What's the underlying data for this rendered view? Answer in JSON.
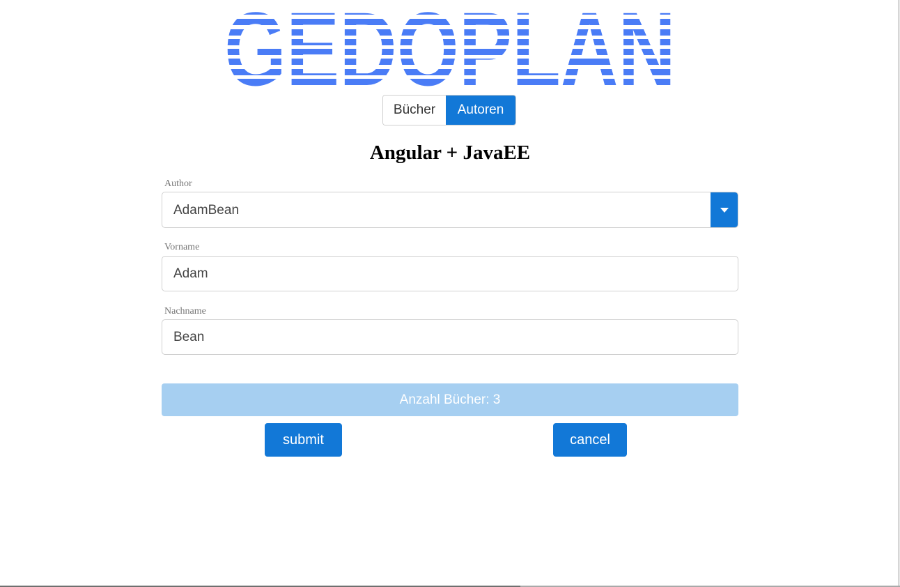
{
  "logo": {
    "text": "GEDOPLAN",
    "color": "#4a7cf6"
  },
  "nav": {
    "books_label": "Bücher",
    "authors_label": "Autoren",
    "active": "authors"
  },
  "page": {
    "title": "Angular + JavaEE"
  },
  "form": {
    "author_label": "Author",
    "author_selected": "AdamBean",
    "vorname_label": "Vorname",
    "vorname_value": "Adam",
    "nachname_label": "Nachname",
    "nachname_value": "Bean"
  },
  "info": {
    "book_count_text": "Anzahl Bücher: 3"
  },
  "actions": {
    "submit_label": "submit",
    "cancel_label": "cancel"
  },
  "colors": {
    "primary": "#1278d7",
    "info_bar": "#a6cff1",
    "logo_blue": "#4a7cf6"
  }
}
